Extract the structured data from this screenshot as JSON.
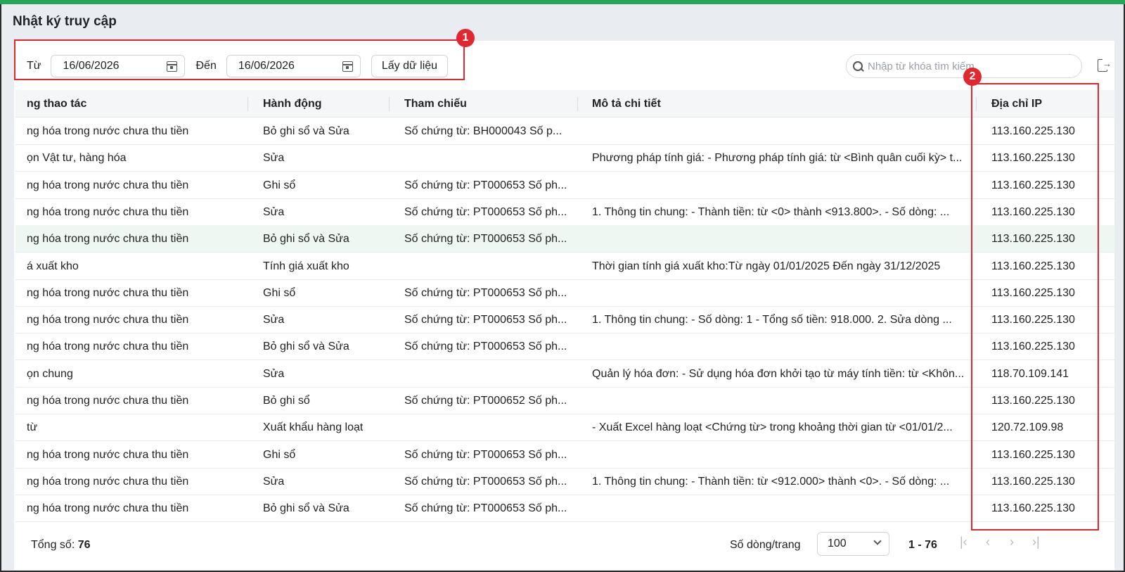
{
  "page": {
    "title": "Nhật ký truy cập"
  },
  "filter": {
    "from_label": "Từ",
    "from_date": "16/06/2026",
    "to_label": "Đến",
    "to_date": "16/06/2026",
    "fetch_button": "Lấy dữ liệu"
  },
  "search": {
    "placeholder": "Nhập từ khóa tìm kiếm"
  },
  "columns": [
    "ng thao tác",
    "Hành động",
    "Tham chiếu",
    "Mô tả chi tiết",
    "Địa chỉ IP"
  ],
  "rows": [
    [
      "ng hóa trong nước chưa thu tiền",
      "Bỏ ghi sổ và Sửa",
      "Số chứng từ: BH000043 Số p...",
      "",
      "113.160.225.130"
    ],
    [
      "ọn Vật tư, hàng hóa",
      "Sửa",
      "",
      "Phương pháp tính giá: - Phương pháp tính giá: từ <Bình quân cuối kỳ> t...",
      "113.160.225.130"
    ],
    [
      "ng hóa trong nước chưa thu tiền",
      "Ghi sổ",
      "Số chứng từ: PT000653 Số ph...",
      "",
      "113.160.225.130"
    ],
    [
      "ng hóa trong nước chưa thu tiền",
      "Sửa",
      "Số chứng từ: PT000653 Số ph...",
      "1. Thông tin chung: - Thành tiền: từ <0> thành <913.800>. - Số dòng: ...",
      "113.160.225.130"
    ],
    [
      "ng hóa trong nước chưa thu tiền",
      "Bỏ ghi sổ và Sửa",
      "Số chứng từ: PT000653 Số ph...",
      "",
      "113.160.225.130"
    ],
    [
      "á xuất kho",
      "Tính giá xuất kho",
      "",
      "Thời gian tính giá xuất kho:Từ ngày 01/01/2025 Đến ngày 31/12/2025",
      "113.160.225.130"
    ],
    [
      "ng hóa trong nước chưa thu tiền",
      "Ghi sổ",
      "Số chứng từ: PT000653 Số ph...",
      "",
      "113.160.225.130"
    ],
    [
      "ng hóa trong nước chưa thu tiền",
      "Sửa",
      "Số chứng từ: PT000653 Số ph...",
      "1. Thông tin chung: - Số dòng: 1 - Tổng số tiền: 918.000. 2. Sửa dòng ...",
      "113.160.225.130"
    ],
    [
      "ng hóa trong nước chưa thu tiền",
      "Bỏ ghi sổ và Sửa",
      "Số chứng từ: PT000653 Số ph...",
      "",
      "113.160.225.130"
    ],
    [
      "ọn chung",
      "Sửa",
      "",
      "Quản lý hóa đơn: - Sử dụng hóa đơn khởi tạo từ máy tính tiền: từ <Khôn...",
      "118.70.109.141"
    ],
    [
      "ng hóa trong nước chưa thu tiền",
      "Bỏ ghi sổ",
      "Số chứng từ: PT000652 Số ph...",
      "",
      "113.160.225.130"
    ],
    [
      "từ",
      "Xuất khẩu hàng loạt",
      "",
      "- Xuất Excel hàng loạt <Chứng từ> trong khoảng thời gian từ <01/01/2...",
      "120.72.109.98"
    ],
    [
      "ng hóa trong nước chưa thu tiền",
      "Ghi sổ",
      "Số chứng từ: PT000653 Số ph...",
      "",
      "113.160.225.130"
    ],
    [
      "ng hóa trong nước chưa thu tiền",
      "Sửa",
      "Số chứng từ: PT000653 Số ph...",
      "1. Thông tin chung: - Thành tiền: từ <912.000> thành <0>. - Số dòng: ...",
      "113.160.225.130"
    ],
    [
      "ng hóa trong nước chưa thu tiền",
      "Bỏ ghi sổ và Sửa",
      "Số chứng từ: PT000653 Số ph...",
      "",
      "113.160.225.130"
    ]
  ],
  "highlighted_row": 4,
  "footer": {
    "total_label": "Tổng số:",
    "total_value": "76",
    "rows_per_page_label": "Số dòng/trang",
    "rows_per_page": "100",
    "range": "1 - 76"
  },
  "annotations": {
    "badge1": "1",
    "badge2": "2"
  },
  "colors": {
    "accent": "#26a65b",
    "annotation": "#e0282e"
  }
}
